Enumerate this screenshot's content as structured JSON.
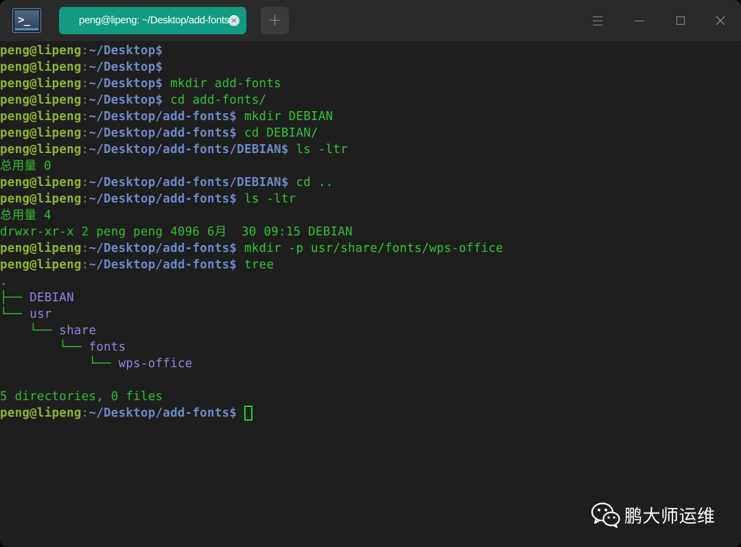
{
  "window": {
    "tab_title": "peng@lipeng: ~/Desktop/add-fonts",
    "tab_close_glyph": "×",
    "new_tab_glyph": "+"
  },
  "terminal": {
    "prompt_user": "peng@lipeng",
    "prompt_sep": ":",
    "lines": [
      {
        "path": "~/Desktop$",
        "cmd": ""
      },
      {
        "path": "~/Desktop$",
        "cmd": ""
      },
      {
        "path": "~/Desktop$",
        "cmd": " mkdir add-fonts"
      },
      {
        "path": "~/Desktop$",
        "cmd": " cd add-fonts/"
      },
      {
        "path": "~/Desktop/add-fonts$",
        "cmd": " mkdir DEBIAN"
      },
      {
        "path": "~/Desktop/add-fonts$",
        "cmd": " cd DEBIAN/"
      },
      {
        "path": "~/Desktop/add-fonts/DEBIAN$",
        "cmd": " ls -ltr"
      },
      {
        "output": "总用量 0"
      },
      {
        "path": "~/Desktop/add-fonts/DEBIAN$",
        "cmd": " cd .."
      },
      {
        "path": "~/Desktop/add-fonts$",
        "cmd": " ls -ltr"
      },
      {
        "output": "总用量 4"
      },
      {
        "output": "drwxr-xr-x 2 peng peng 4096 6月  30 09:15 DEBIAN"
      },
      {
        "path": "~/Desktop/add-fonts$",
        "cmd": " mkdir -p usr/share/fonts/wps-office"
      },
      {
        "path": "~/Desktop/add-fonts$",
        "cmd": " tree"
      }
    ],
    "tree": [
      {
        "branch": ".",
        "name": ""
      },
      {
        "branch": "├── ",
        "name": "DEBIAN"
      },
      {
        "branch": "└── ",
        "name": "usr"
      },
      {
        "branch": "    └── ",
        "name": "share"
      },
      {
        "branch": "        └── ",
        "name": "fonts"
      },
      {
        "branch": "            └── ",
        "name": "wps-office"
      }
    ],
    "summary": "5 directories, 0 files",
    "final_prompt_path": "~/Desktop/add-fonts$"
  },
  "watermark": {
    "text": "鹏大师运维",
    "icon": "wechat-icon"
  },
  "colors": {
    "titlebar": "#2a2a2a",
    "background": "#1e1e1e",
    "tab_active": "#129b80",
    "user": "#8fb52c",
    "path": "#6b8bc9",
    "command": "#30c531",
    "directory": "#8d86e0"
  }
}
